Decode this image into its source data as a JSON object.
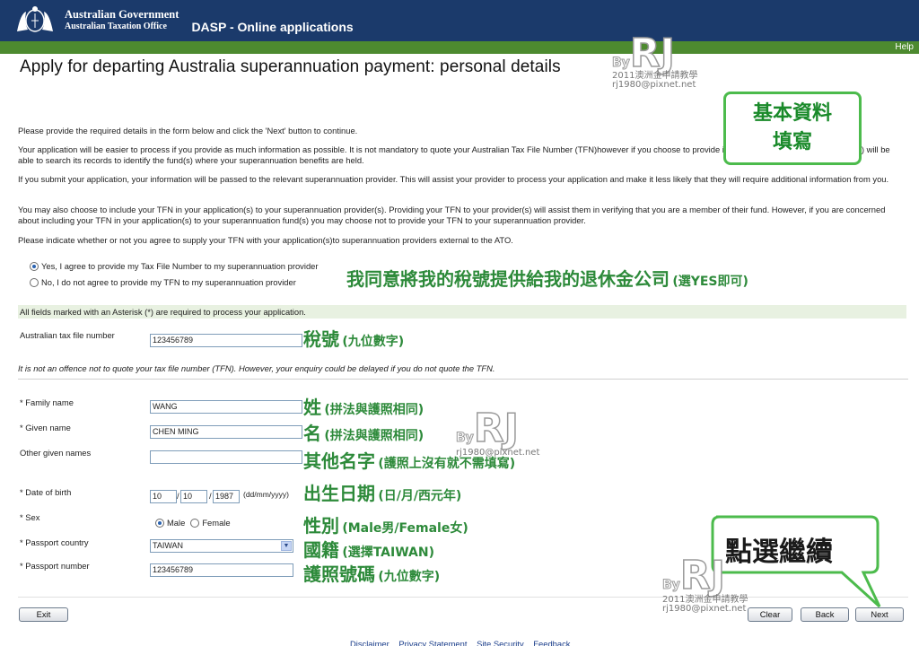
{
  "header": {
    "gov_line1": "Australian Government",
    "gov_line2": "Australian Taxation Office",
    "app_title": "DASP - Online applications",
    "help": "Help"
  },
  "page_title": "Apply for departing Australia superannuation payment: personal details",
  "paragraphs": {
    "p1": "Please provide the required details in the form below and click the 'Next' button to continue.",
    "p2": "Your application will be easier to process if you provide as much information as possible. It is not mandatory to quote your Australian Tax File Number (TFN)however if you choose to provide it, the Australian Taxation Office (ATO) will be able to search its records to identify the fund(s) where your superannuation benefits are held.",
    "p3": "If you submit your application, your information will be passed to the relevant superannuation provider. This will assist your provider to process your application and make it less likely that they will require additional information from you.",
    "p4": "You may also choose to include your TFN in your application(s) to your superannuation provider(s). Providing your TFN to your provider(s) will assist them in verifying that you are a member of their fund. However, if you are concerned about including your TFN in your application(s) to your superannuation fund(s) you may choose not to provide your TFN to your superannuation provider.",
    "p5": "Please indicate whether or not you agree to supply your TFN with your application(s)to superannuation providers external to the ATO."
  },
  "tfn_consent": {
    "yes_label": "Yes, I agree to provide my Tax File Number to my superannuation provider",
    "no_label": "No, I do not agree to provide my TFN to my superannuation provider",
    "selected": "yes"
  },
  "required_note": "All fields marked with an Asterisk (*) are required to process your application.",
  "form": {
    "tfn_label": "Australian tax file number",
    "tfn_value": "123456789",
    "tfn_note": "It is not an offence not to quote your tax file number (TFN). However, your enquiry could be delayed if you do not quote the TFN.",
    "family_label": "* Family name",
    "family_value": "WANG",
    "given_label": "* Given name",
    "given_value": "CHEN MING",
    "other_label": "Other given names",
    "other_value": "",
    "dob_label": "* Date of birth",
    "dob_day": "10",
    "dob_month": "10",
    "dob_year": "1987",
    "dob_format": "(dd/mm/yyyy)",
    "dob_sep": "/",
    "sex_label": "* Sex",
    "sex_male": "Male",
    "sex_female": "Female",
    "sex_selected": "Male",
    "country_label": "* Passport country",
    "country_value": "TAIWAN",
    "passport_label": "* Passport number",
    "passport_value": "123456789"
  },
  "buttons": {
    "exit": "Exit",
    "clear": "Clear",
    "back": "Back",
    "next": "Next"
  },
  "footer": {
    "disclaimer": "Disclaimer",
    "privacy": "Privacy Statement",
    "security": "Site Security",
    "feedback": "Feedback"
  },
  "annotations": {
    "basic_info_line1": "基本資料",
    "basic_info_line2": "填寫",
    "consent_big": "我同意將我的稅號提供給我的退休金公司",
    "consent_small": "(選YES即可)",
    "tfn_big": "稅號",
    "tfn_small": "(九位數字)",
    "family_big": "姓",
    "family_small": "(拼法與護照相同)",
    "given_big": "名",
    "given_small": "(拼法與護照相同)",
    "other_big": "其他名字",
    "other_small": "(護照上沒有就不需填寫)",
    "dob_big": "出生日期",
    "dob_small": "(日/月/西元年)",
    "sex_big": "性別",
    "sex_small": "(Male男/Female女)",
    "country_big": "國籍",
    "country_small": "(選擇TAIWAN)",
    "passport_big": "護照號碼",
    "passport_small": "(九位數字)",
    "continue": "點選繼續"
  },
  "watermark": {
    "by": "By",
    "rj": "RJ",
    "line1": "2011澳洲金申請教學",
    "line2": "rj1980@pixnet.net"
  },
  "colors": {
    "header_bg": "#1b3a6b",
    "subbar_bg": "#4d8a2f",
    "annotation_green": "#2d8a3a"
  }
}
